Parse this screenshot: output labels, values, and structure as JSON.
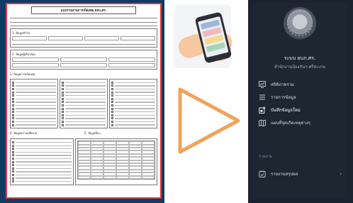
{
  "form": {
    "title": "แบบรายงานการเกิดเหตุ ยจบ.ศร.",
    "section1": "1. ข้อมูลทั่วไป",
    "section2": "2. ข้อมูลผู้เกี่ยวข้อง",
    "section3": "3. ข้อมูลการเกิดเหตุ",
    "section4": "4. ข้อมูลความเสียหาย",
    "section5": "5. ข้อมูลอื่นๆ"
  },
  "app": {
    "brand_name": "ระบบ ยบภ.ศร.",
    "brand_sub": "สำนักงานป้องกันฯ ศรีสะเกษ",
    "menu": [
      {
        "label": "สถิติภาพรวม",
        "icon": "chart-icon"
      },
      {
        "label": "รายการข้อมูล",
        "icon": "list-icon"
      },
      {
        "label": "บันทึกข้อมูลใหม่",
        "icon": "add-doc-icon"
      },
      {
        "label": "แผนที่จุดเกิดเหตุต่างๆ",
        "icon": "map-icon"
      }
    ],
    "section_label": "รายงาน",
    "report_item": "รายงานสรุปผล",
    "colors": {
      "panel": "#1e2632",
      "accent": "#6f8bb0",
      "arrow": "#f0a35a"
    }
  }
}
